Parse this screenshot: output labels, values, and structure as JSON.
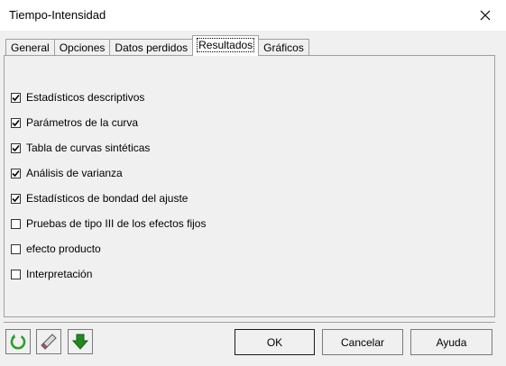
{
  "window": {
    "title": "Tiempo-Intensidad",
    "close_glyph": "✕"
  },
  "tabs": [
    {
      "label": "General",
      "active": false
    },
    {
      "label": "Opciones",
      "active": false
    },
    {
      "label": "Datos perdidos",
      "active": false
    },
    {
      "label": "Resultados",
      "active": true
    },
    {
      "label": "Gráficos",
      "active": false
    }
  ],
  "options": [
    {
      "label": "Estadísticos descriptivos",
      "checked": true
    },
    {
      "label": "Parámetros de la curva",
      "checked": true
    },
    {
      "label": "Tabla de curvas sintéticas",
      "checked": true
    },
    {
      "label": "Análisis de varianza",
      "checked": true
    },
    {
      "label": "Estadísticos de bondad del ajuste",
      "checked": true
    },
    {
      "label": "Pruebas de tipo III de los efectos fijos",
      "checked": false
    },
    {
      "label": "efecto producto",
      "checked": false
    },
    {
      "label": "Interpretación",
      "checked": false
    }
  ],
  "toolbar": {
    "reset_icon": "refresh-icon",
    "clear_icon": "eraser-icon",
    "down_icon": "down-arrow-icon"
  },
  "buttons": {
    "ok": "OK",
    "cancel": "Cancelar",
    "help": "Ayuda"
  },
  "colors": {
    "refresh": "#2e9e2e",
    "down_arrow": "#1f8a1f",
    "eraser": "#c94b5a"
  }
}
